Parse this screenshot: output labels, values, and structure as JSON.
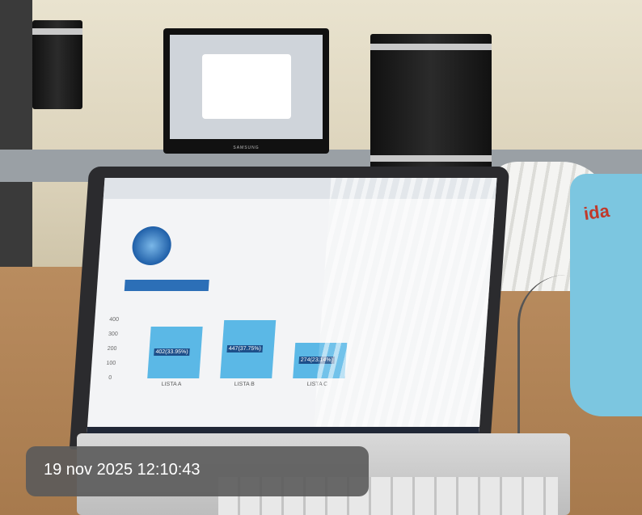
{
  "timestamp": "19 nov 2025 12:10:43",
  "scene": {
    "objects": [
      "laptop",
      "monitor",
      "desktop-tower",
      "plastic-chair",
      "bag",
      "table",
      "cable"
    ]
  },
  "laptop_screen": {
    "chart_data": {
      "type": "bar",
      "categories": [
        "LISTA A",
        "LISTA B",
        "LISTA C"
      ],
      "values": [
        402,
        447,
        274
      ],
      "labels": [
        "402(33.95%)",
        "447(37.75%)",
        "274(23.14%)"
      ],
      "yticks": [
        "400",
        "300",
        "200",
        "100",
        "0"
      ]
    }
  },
  "colors": {
    "bar": "#5bb8e6",
    "stamp_bg": "#5a5a5a"
  }
}
